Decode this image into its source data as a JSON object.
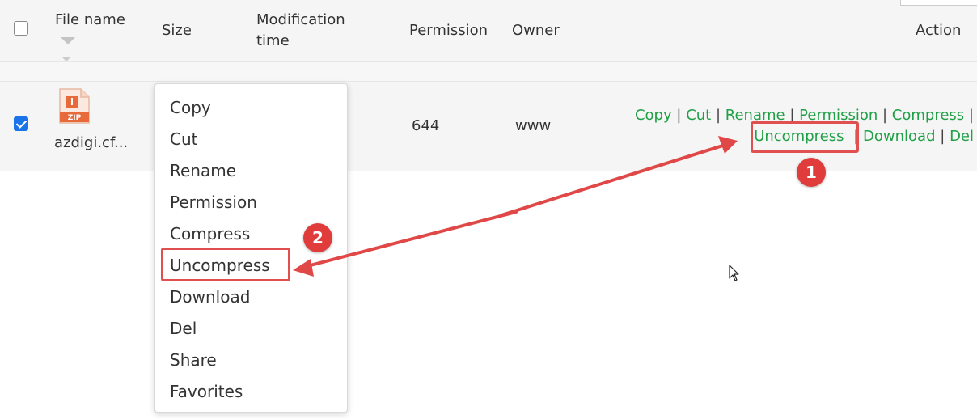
{
  "header": {
    "file_name": "File name",
    "size": "Size",
    "modification_time_line1": "Modification",
    "modification_time_line2": "time",
    "permission": "Permission",
    "owner": "Owner",
    "action": "Action"
  },
  "row": {
    "file_icon_label": "ZIP",
    "file_name": "azdigi.cf...",
    "permission": "644",
    "owner": "www",
    "actions": {
      "copy": "Copy",
      "cut": "Cut",
      "rename": "Rename",
      "permission": "Permission",
      "compress": "Compress",
      "uncompress": "Uncompress",
      "download": "Download",
      "del": "Del",
      "separator": "|"
    }
  },
  "context_menu": {
    "items": [
      "Copy",
      "Cut",
      "Rename",
      "Permission",
      "Compress",
      "Uncompress",
      "Download",
      "Del",
      "Share",
      "Favorites"
    ]
  },
  "annotations": {
    "badge1": "1",
    "badge2": "2"
  },
  "colors": {
    "action_link": "#20a046",
    "annotation_red": "#e05050",
    "checkbox_checked": "#1a73e8"
  }
}
